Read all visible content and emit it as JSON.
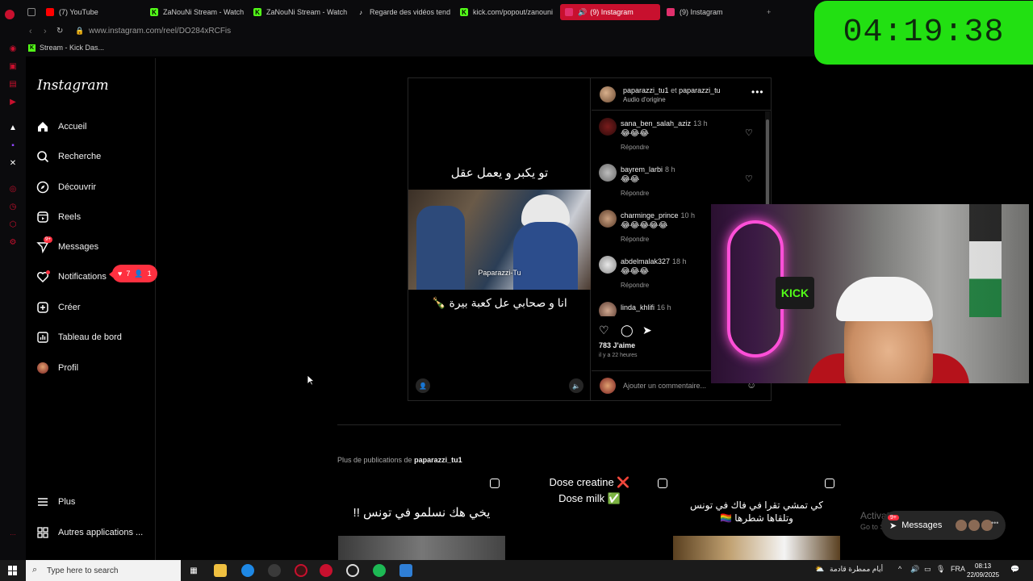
{
  "browser": {
    "tabs": [
      {
        "label": "(7) YouTube",
        "icon": "youtube-icon"
      },
      {
        "label": "ZaNouNi Stream - Watch",
        "icon": "kick-icon"
      },
      {
        "label": "ZaNouNi Stream - Watch",
        "icon": "kick-icon"
      },
      {
        "label": "Regarde des vidéos tend",
        "icon": "tiktok-icon"
      },
      {
        "label": "kick.com/popout/zanouni",
        "icon": "kick-icon"
      },
      {
        "label": "(9) Instagram",
        "icon": "instagram-icon"
      },
      {
        "label": "(9) Instagram",
        "icon": "instagram-icon"
      }
    ],
    "url": "www.instagram.com/reel/DO284xRCFis",
    "bookmark": "Stream - Kick Das..."
  },
  "timer": "04:19:38",
  "instagram": {
    "logo": "Instagram",
    "nav": [
      {
        "label": "Accueil",
        "icon": "home-icon"
      },
      {
        "label": "Recherche",
        "icon": "search-icon"
      },
      {
        "label": "Découvrir",
        "icon": "compass-icon"
      },
      {
        "label": "Reels",
        "icon": "reels-icon"
      },
      {
        "label": "Messages",
        "icon": "messenger-icon",
        "badge": "9+"
      },
      {
        "label": "Notifications",
        "icon": "heart-icon"
      },
      {
        "label": "Créer",
        "icon": "plus-icon"
      },
      {
        "label": "Tableau de bord",
        "icon": "chart-icon"
      },
      {
        "label": "Profil",
        "icon": "profile-avatar-icon"
      }
    ],
    "nav_bottom": [
      {
        "label": "Plus",
        "icon": "menu-icon"
      },
      {
        "label": "Autres applications ...",
        "icon": "apps-icon"
      }
    ],
    "notifications_popup": {
      "likes": "7",
      "follows": "1"
    }
  },
  "post": {
    "caption_top": "تو يكبر و يعمل عقل",
    "watermark": "Paparazzi-Tu",
    "caption_bottom": "انا و صحابي عل كعبة بيرة 🍾",
    "author": "paparazzi_tu1",
    "author_join": "et",
    "coauthor": "paparazzi_tu",
    "audio": "Audio d'origine",
    "comments": [
      {
        "user": "sana_ben_salah_aziz",
        "time": "13 h",
        "text": "😂😂😂",
        "reply": "Répondre"
      },
      {
        "user": "bayrem_larbi",
        "time": "8 h",
        "text": "😂😂",
        "reply": "Répondre"
      },
      {
        "user": "charminge_prince",
        "time": "10 h",
        "text": "😂😂😂😂😂",
        "reply": "Répondre"
      },
      {
        "user": "abdelmalak327",
        "time": "18 h",
        "text": "😂😂😂",
        "reply": "Répondre"
      },
      {
        "user": "linda_khlifi",
        "time": "16 h",
        "text": "",
        "reply": ""
      }
    ],
    "likes": "783 J'aime",
    "posted_ago": "il y a 22 heures",
    "comment_placeholder": "Ajouter un commentaire..."
  },
  "webcam_sign": "KICK",
  "more_publications": {
    "prefix": "Plus de publications de",
    "user": "paparazzi_tu1",
    "items": [
      {
        "text": "يخي هك نسلمو في تونس !!"
      },
      {
        "text": "Dose creatine ❌\nDose milk ✅"
      },
      {
        "text": "كي تمشي تقرا في فاك في تونس\nوتلقاها شطرها 🏳️‍🌈"
      }
    ]
  },
  "windows": {
    "activate_title": "Activate Windows",
    "activate_sub": "Go to Settings to activate Windows.",
    "search_placeholder": "Type here to search",
    "weather": "أيام ممطرة قادمة",
    "lang": "FRA",
    "time": "08:13",
    "date": "22/09/2025"
  },
  "messages_pill": {
    "label": "Messages",
    "badge": "9+"
  },
  "colors": {
    "timer": "#22e012",
    "ig_badge": "#ff3040",
    "opera": "#c8102e",
    "kick": "#53fc18"
  }
}
